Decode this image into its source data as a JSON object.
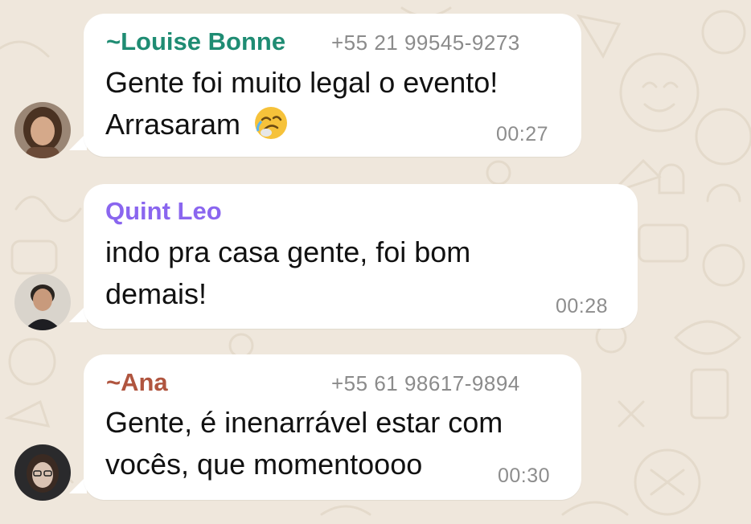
{
  "chat": {
    "messages": [
      {
        "sender": "~Louise Bonne",
        "phone": "+55 21 99545-9273",
        "lines": [
          "Gente foi muito legal o evento!",
          "Arrasaram"
        ],
        "time": "00:27",
        "sender_color": "#1f8c73"
      },
      {
        "sender": "Quint Leo",
        "phone": "",
        "lines": [
          "indo pra casa gente, foi bom",
          "demais!"
        ],
        "time": "00:28",
        "sender_color": "#8a66ef"
      },
      {
        "sender": "~Ana",
        "phone": "+55 61 98617-9894",
        "lines": [
          "Gente, é inenarrável estar com",
          "vocês, que momentoooo"
        ],
        "time": "00:30",
        "sender_color": "#b0553f"
      }
    ]
  },
  "icons": {
    "message_1_emoji": "crying-laughing-face-emoji"
  }
}
